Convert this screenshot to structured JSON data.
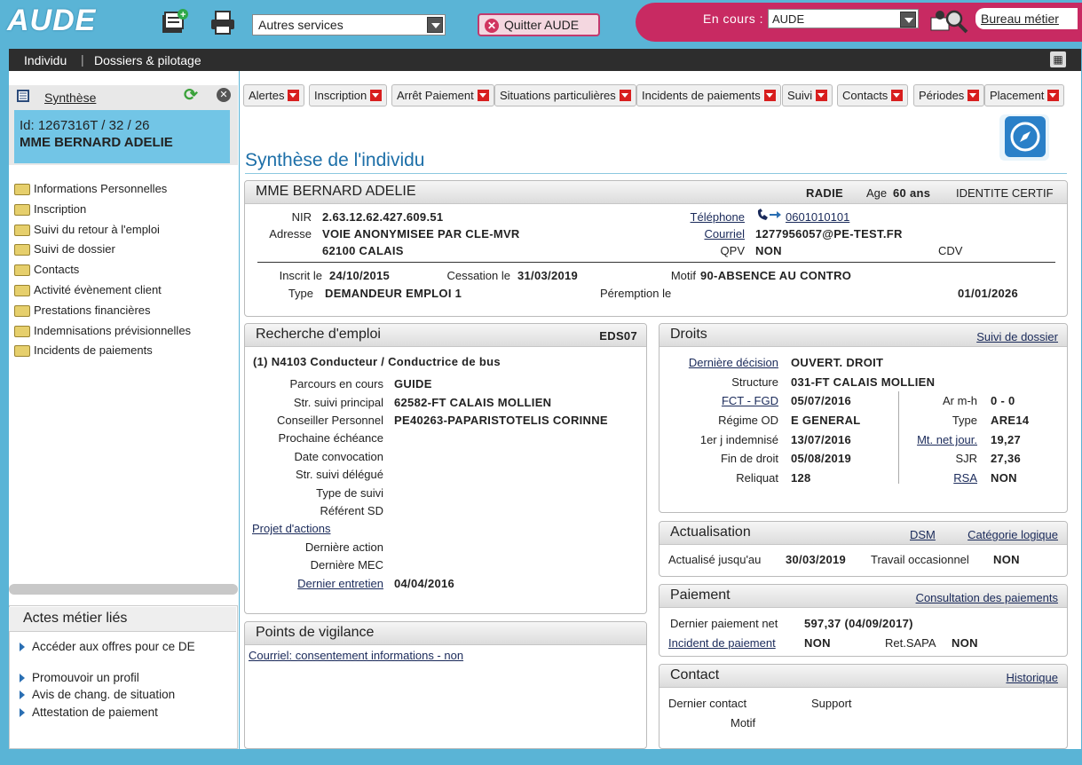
{
  "topbar": {
    "logo": "AUDE",
    "services_select": "Autres services",
    "quit_label": "Quitter AUDE",
    "encours_label": "En cours :",
    "encours_value": "AUDE",
    "bureau_label": "Bureau métier"
  },
  "nav": {
    "individu": "Individu",
    "sep": "|",
    "dossiers": "Dossiers & pilotage"
  },
  "left": {
    "synthese_label": "Synthèse",
    "id_line": "Id: 1267316T / 32 / 26",
    "name": "MME BERNARD ADELIE",
    "menu": [
      "Informations Personnelles",
      "Inscription",
      "Suivi du retour à l'emploi",
      "Suivi de dossier",
      "Contacts",
      "Activité évènement client",
      "Prestations financières",
      "Indemnisations prévisionnelles",
      "Incidents de paiements"
    ],
    "actes_title": "Actes métier liés",
    "actes": [
      "Accéder aux offres pour ce DE",
      "Promouvoir un profil",
      "Avis de chang. de situation",
      "Attestation de paiement"
    ]
  },
  "tabs": [
    "Alertes",
    "Inscription",
    "Arrêt Paiement",
    "Situations particulières",
    "Incidents de paiements",
    "Suivi",
    "Contacts",
    "Périodes",
    "Placement"
  ],
  "page_title": "Synthèse de l'individu",
  "identity": {
    "name": "MME BERNARD ADELIE",
    "status": "RADIE",
    "age_label": "Age",
    "age_value": "60 ans",
    "identite": "IDENTITE CERTIF",
    "nir_label": "NIR",
    "nir": "2.63.12.62.427.609.51",
    "adresse_label": "Adresse",
    "adresse1": "VOIE ANONYMISEE PAR CLE-MVR",
    "adresse2": "62100 CALAIS",
    "tel_label": "Téléphone",
    "tel": "0601010101",
    "courriel_label": "Courriel",
    "courriel": "1277956057@PE-TEST.FR",
    "qpv_label": "QPV",
    "qpv": "NON",
    "cdv_label": "CDV",
    "inscrit_label": "Inscrit le",
    "inscrit": "24/10/2015",
    "cessation_label": "Cessation le",
    "cessation": "31/03/2019",
    "motif_label": "Motif",
    "motif": "90-ABSENCE AU CONTRO",
    "type_label": "Type",
    "type": "DEMANDEUR EMPLOI 1",
    "peremption_label": "Péremption le",
    "peremption": "01/01/2026"
  },
  "recherche": {
    "title": "Recherche d'emploi",
    "code": "EDS07",
    "metier": "(1) N4103 Conducteur / Conductrice de bus",
    "rows": [
      {
        "label": "Parcours en cours",
        "value": "GUIDE"
      },
      {
        "label": "Str. suivi principal",
        "value": "62582-FT CALAIS MOLLIEN"
      },
      {
        "label": "Conseiller Personnel",
        "value": "PE40263-PAPARISTOTELIS CORINNE"
      },
      {
        "label": "Prochaine échéance",
        "value": ""
      },
      {
        "label": "Date convocation",
        "value": ""
      },
      {
        "label": "Str. suivi délégué",
        "value": ""
      },
      {
        "label": "Type de suivi",
        "value": ""
      },
      {
        "label": "Référent SD",
        "value": ""
      }
    ],
    "projet_label": "Projet d'actions",
    "derniere_action_label": "Dernière action",
    "derniere_mec_label": "Dernière MEC",
    "dernier_entretien_label": "Dernier entretien",
    "dernier_entretien": "04/04/2016"
  },
  "vigilance": {
    "title": "Points de vigilance",
    "item": "Courriel: consentement informations - non"
  },
  "droits": {
    "title": "Droits",
    "suivi_link": "Suivi de dossier",
    "derniere_decision_label": "Dernière décision",
    "derniere_decision": "OUVERT. DROIT",
    "structure_label": "Structure",
    "structure": "031-FT CALAIS MOLLIEN",
    "fct_label": "FCT - FGD",
    "fct": "05/07/2016",
    "regime_label": "Régime OD",
    "regime": "E GENERAL",
    "jindemnise_label": "1er j indemnisé",
    "jindemnise": "13/07/2016",
    "fin_label": "Fin de droit",
    "fin": "05/08/2019",
    "reliquat_label": "Reliquat",
    "reliquat": "128",
    "armh_label": "Ar m-h",
    "armh": "0 - 0",
    "type_label": "Type",
    "type": "ARE14",
    "mtnet_label": "Mt. net jour.",
    "mtnet": "19,27",
    "sjr_label": "SJR",
    "sjr": "27,36",
    "rsa_label": "RSA",
    "rsa": "NON"
  },
  "actualisation": {
    "title": "Actualisation",
    "dsm": "DSM",
    "categorie": "Catégorie logique",
    "jusqu_label": "Actualisé jusqu'au",
    "jusqu": "30/03/2019",
    "travail_label": "Travail occasionnel",
    "travail": "NON"
  },
  "paiement": {
    "title": "Paiement",
    "consult": "Consultation des paiements",
    "dernier_label": "Dernier paiement net",
    "dernier": "597,37 (04/09/2017)",
    "incident_label": "Incident de paiement",
    "incident": "NON",
    "sapa_label": "Ret.SAPA",
    "sapa": "NON"
  },
  "contact": {
    "title": "Contact",
    "historique": "Historique",
    "dernier_label": "Dernier contact",
    "support_label": "Support",
    "motif_label": "Motif"
  }
}
